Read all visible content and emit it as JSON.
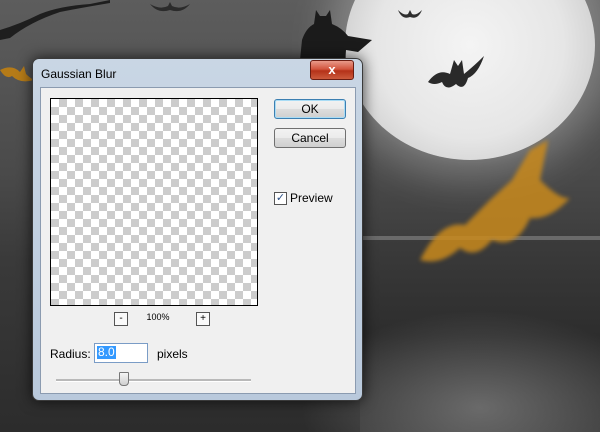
{
  "dialog": {
    "title": "Gaussian Blur",
    "close_label": "x",
    "ok_label": "OK",
    "cancel_label": "Cancel",
    "preview_label": "Preview",
    "preview_checked": true,
    "zoom_minus": "-",
    "zoom_plus": "+",
    "zoom_level": "100%",
    "radius_label": "Radius:",
    "radius_value": "8.0",
    "radius_unit": "pixels"
  },
  "colors": {
    "close_button": "#c8432a",
    "selection": "#3399ff",
    "bat_orange": "#c98a1c"
  },
  "icons": {
    "close": "close-icon",
    "checkbox": "checkmark-icon"
  }
}
